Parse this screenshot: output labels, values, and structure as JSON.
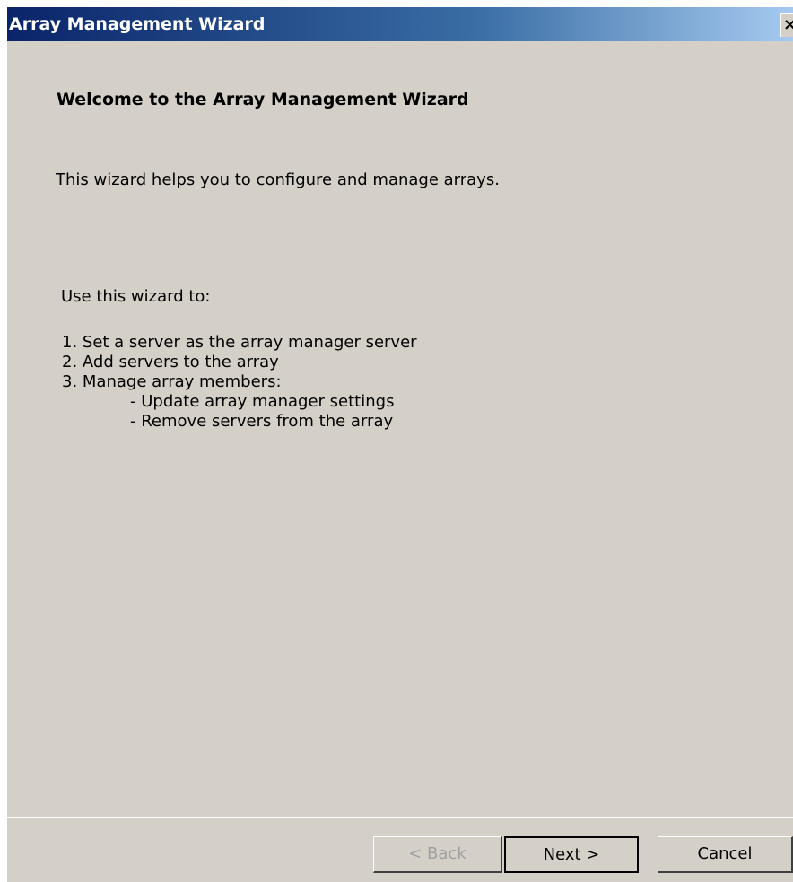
{
  "window": {
    "title": "Array Management Wizard",
    "close_label": "×"
  },
  "page": {
    "heading": "Welcome to the Array Management Wizard",
    "intro": "This wizard helps you to configure and manage arrays.",
    "use_label": "Use this wizard to:",
    "steps": [
      "1. Set a server as the array manager server",
      "2. Add servers to the array",
      "3. Manage array members:",
      "- Update array manager settings",
      "- Remove servers from the array"
    ]
  },
  "buttons": {
    "back": {
      "label": "< Back",
      "enabled": false
    },
    "next": {
      "label": "Next >",
      "enabled": true,
      "default": true
    },
    "cancel": {
      "label": "Cancel",
      "enabled": true
    }
  },
  "colors": {
    "titlebar_start": "#0a246a",
    "titlebar_end": "#a6caf0",
    "dialog_background": "#d4d0c8",
    "disabled_text": "#a0a0a0"
  }
}
